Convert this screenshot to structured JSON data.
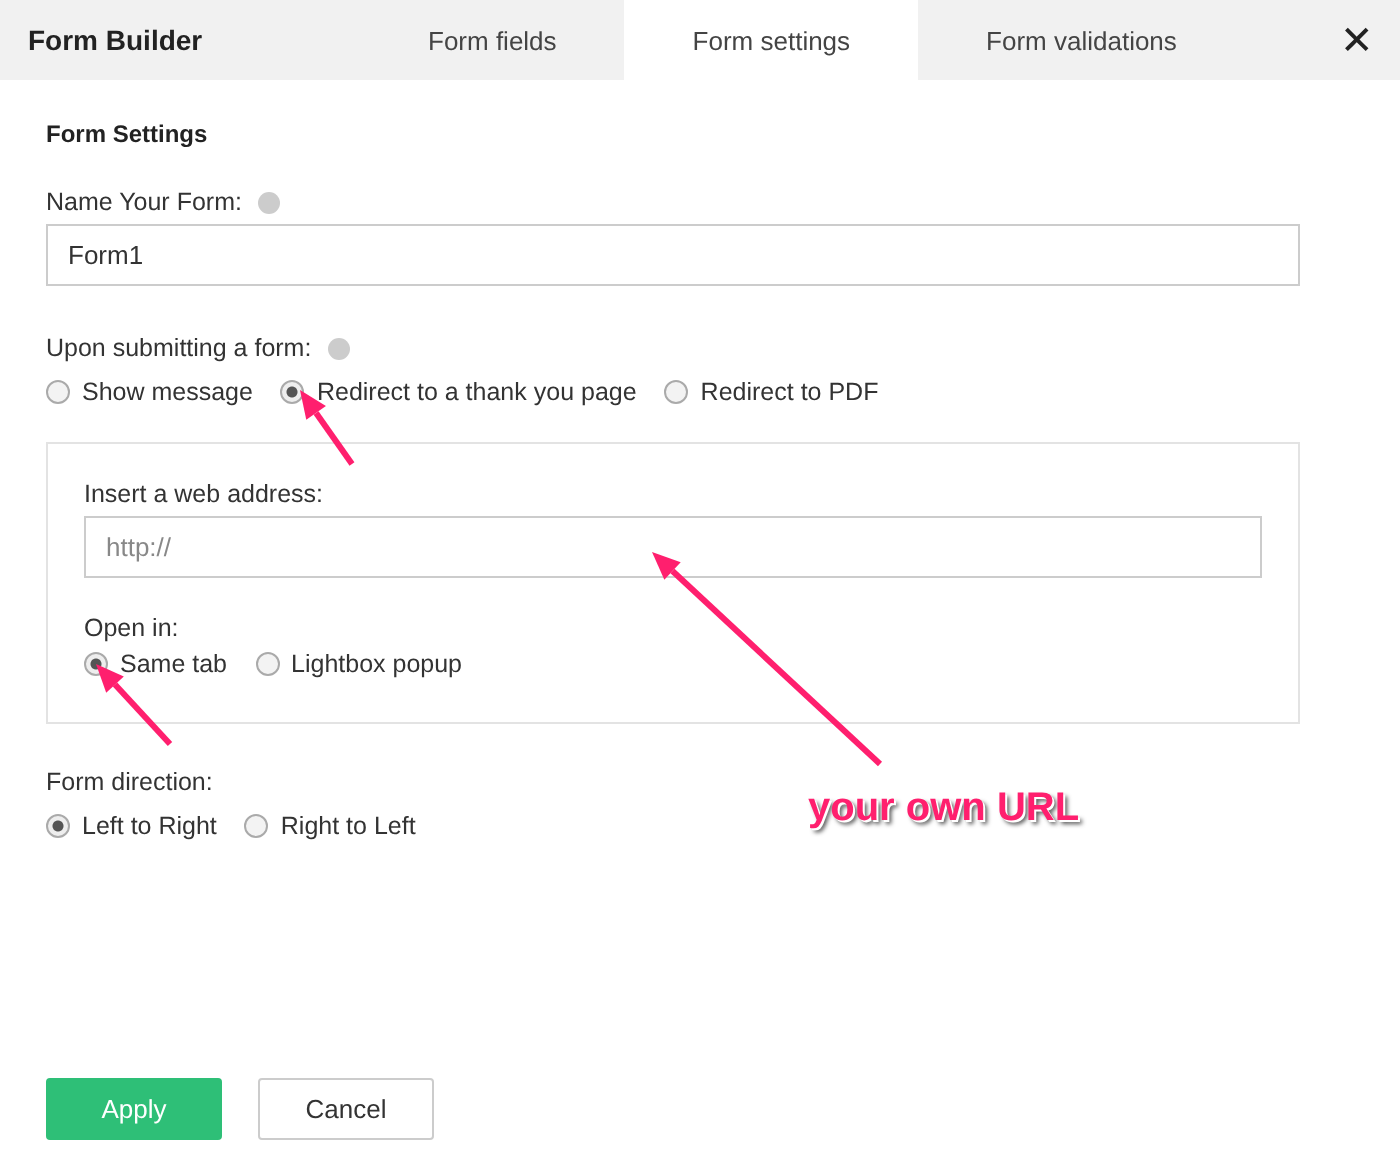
{
  "header": {
    "title": "Form Builder",
    "tabs": [
      {
        "label": "Form fields",
        "selected": false
      },
      {
        "label": "Form settings",
        "selected": true
      },
      {
        "label": "Form validations",
        "selected": false
      }
    ],
    "close": "✕"
  },
  "section_title": "Form Settings",
  "name_field": {
    "label": "Name Your Form:",
    "value": "Form1",
    "help": true
  },
  "submit_action": {
    "label": "Upon submitting a form:",
    "help": true,
    "options": [
      {
        "label": "Show message",
        "selected": false
      },
      {
        "label": "Redirect to a thank you page",
        "selected": true
      },
      {
        "label": "Redirect to PDF",
        "selected": false
      }
    ]
  },
  "redirect_panel": {
    "label": "Insert a web address:",
    "placeholder": "http://",
    "open_in": {
      "label": "Open in:",
      "options": [
        {
          "label": "Same tab",
          "selected": true
        },
        {
          "label": "Lightbox popup",
          "selected": false
        }
      ]
    }
  },
  "direction": {
    "label": "Form direction:",
    "options": [
      {
        "label": "Left to Right",
        "selected": true
      },
      {
        "label": "Right to Left",
        "selected": false
      }
    ]
  },
  "buttons": [
    {
      "label": "Apply",
      "kind": "primary"
    },
    {
      "label": "Cancel",
      "kind": "secondary"
    }
  ],
  "annotation": {
    "text": "your own URL"
  }
}
